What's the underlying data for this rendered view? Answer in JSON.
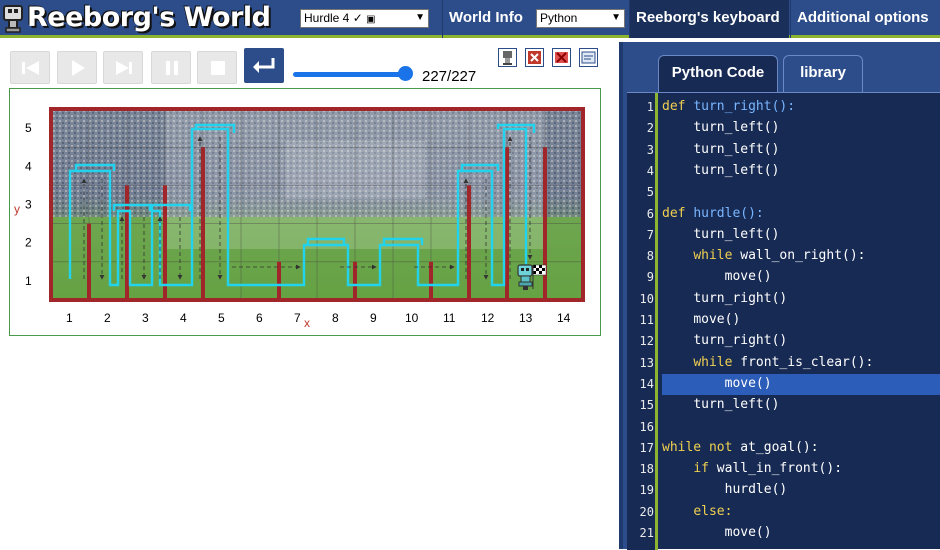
{
  "app": {
    "title": "Reeborg's World"
  },
  "header": {
    "world_select": "Hurdle 4 ✓",
    "world_info": "World Info",
    "language_select": "Python",
    "keyboard": "Reeborg's keyboard",
    "options": "Additional options"
  },
  "controls": {
    "steps": "227/227",
    "slider_progress": 1.0
  },
  "world": {
    "x_ticks": [
      "1",
      "2",
      "3",
      "4",
      "5",
      "6",
      "7",
      "8",
      "9",
      "10",
      "11",
      "12",
      "13",
      "14"
    ],
    "y_ticks": [
      "1",
      "2",
      "3",
      "4",
      "5"
    ],
    "x_label": "x",
    "y_label": "y"
  },
  "panel": {
    "tab_python": "Python Code",
    "tab_library": "library",
    "highlight_line": 14,
    "lines": [
      {
        "n": "1",
        "text": "def turn_right():",
        "ind": 0,
        "kw": [
          "def"
        ]
      },
      {
        "n": "2",
        "text": "turn_left()",
        "ind": 1
      },
      {
        "n": "3",
        "text": "turn_left()",
        "ind": 1
      },
      {
        "n": "4",
        "text": "turn_left()",
        "ind": 1
      },
      {
        "n": "5",
        "text": "",
        "ind": 0
      },
      {
        "n": "6",
        "text": "def hurdle():",
        "ind": 0,
        "kw": [
          "def"
        ]
      },
      {
        "n": "7",
        "text": "turn_left()",
        "ind": 1
      },
      {
        "n": "8",
        "text": "while wall_on_right():",
        "ind": 1,
        "kw": [
          "while"
        ]
      },
      {
        "n": "9",
        "text": "move()",
        "ind": 2
      },
      {
        "n": "10",
        "text": "turn_right()",
        "ind": 1
      },
      {
        "n": "11",
        "text": "move()",
        "ind": 1
      },
      {
        "n": "12",
        "text": "turn_right()",
        "ind": 1
      },
      {
        "n": "13",
        "text": "while front_is_clear():",
        "ind": 1,
        "kw": [
          "while"
        ]
      },
      {
        "n": "14",
        "text": "move()",
        "ind": 2
      },
      {
        "n": "15",
        "text": "turn_left()",
        "ind": 1
      },
      {
        "n": "16",
        "text": "",
        "ind": 0
      },
      {
        "n": "17",
        "text": "while not at_goal():",
        "ind": 0,
        "kw": [
          "while",
          "not"
        ]
      },
      {
        "n": "18",
        "text": "if wall_in_front():",
        "ind": 1,
        "kw": [
          "if"
        ]
      },
      {
        "n": "19",
        "text": "hurdle()",
        "ind": 2
      },
      {
        "n": "20",
        "text": "else:",
        "ind": 1,
        "kw": [
          "else:"
        ]
      },
      {
        "n": "21",
        "text": "move()",
        "ind": 2
      }
    ]
  },
  "colors": {
    "accent": "#2d4d8a",
    "trace": "#22d3ee",
    "wall": "#a0262a",
    "highlight": "#2c5db8"
  }
}
